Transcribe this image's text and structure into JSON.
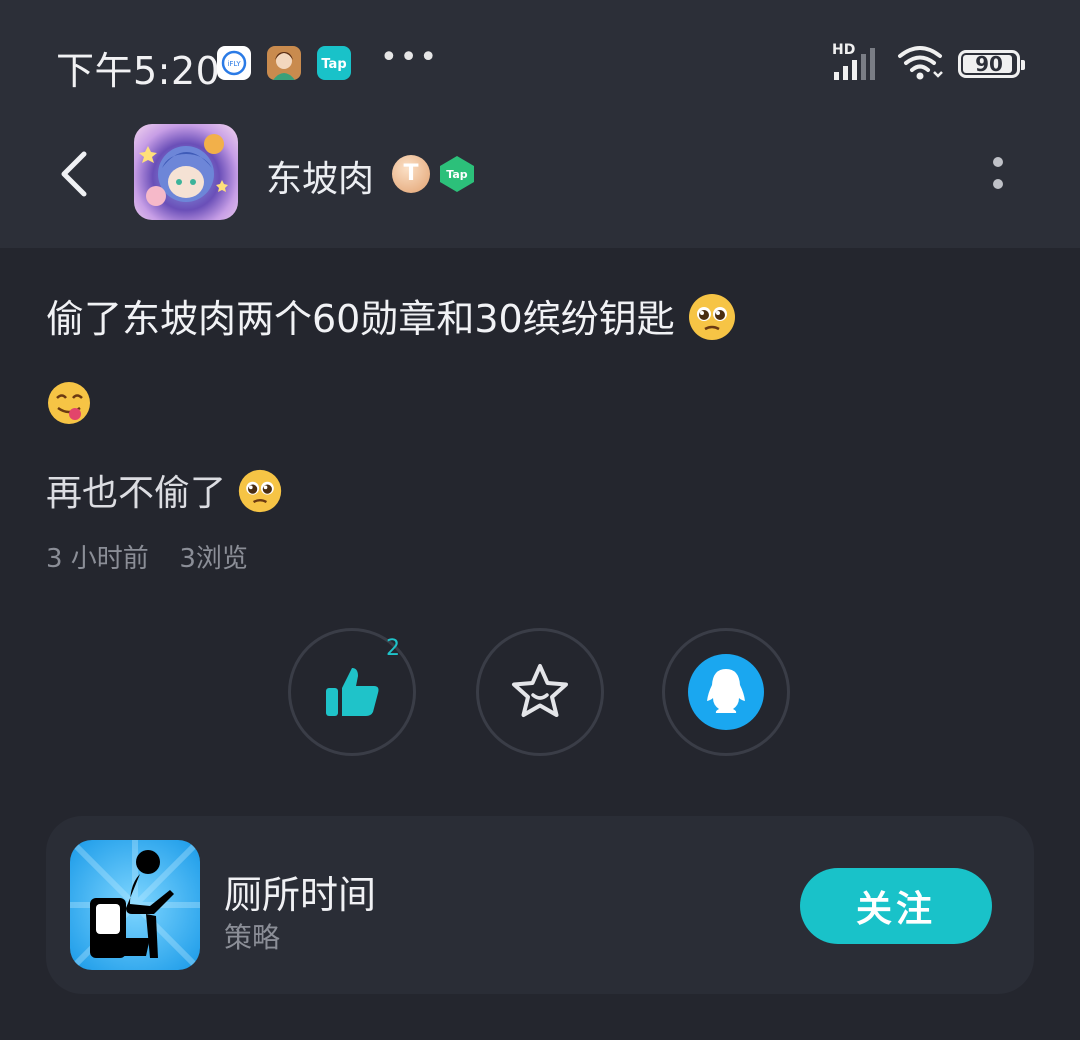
{
  "status_bar": {
    "time": "下午5:20",
    "signal_label": "HD",
    "battery": "90",
    "icons": [
      "ifly-icon",
      "avatar-app-icon",
      "tap-icon",
      "more-notifications-icon",
      "signal-icon",
      "wifi-icon",
      "battery-icon"
    ]
  },
  "header": {
    "username": "东坡肉",
    "level_badge": "T",
    "platform_badge": "Tap"
  },
  "post": {
    "title": "偷了东坡肉两个60勋章和30缤纷钥匙",
    "line3": "再也不偷了",
    "time_ago": "3 小时前",
    "views": "3浏览"
  },
  "actions": {
    "like_count": "2"
  },
  "app_card": {
    "name": "厕所时间",
    "category": "策略",
    "follow_label": "关注"
  },
  "colors": {
    "accent": "#19c2c9",
    "qq_blue": "#1aa7f0",
    "background": "#24262e",
    "header_bg": "#2c2f38"
  }
}
